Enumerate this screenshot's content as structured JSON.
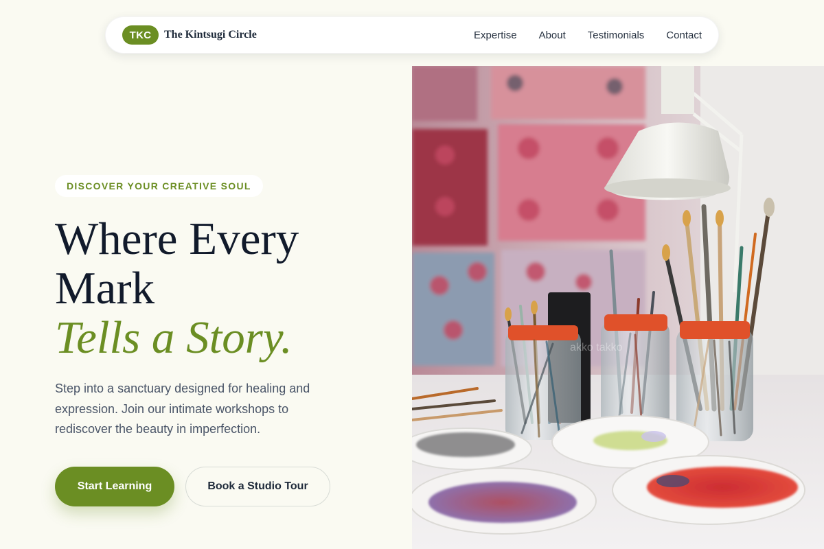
{
  "nav": {
    "badge": "TKC",
    "brand": "The Kintsugi Circle",
    "links": [
      {
        "label": "Expertise"
      },
      {
        "label": "About"
      },
      {
        "label": "Testimonials"
      },
      {
        "label": "Contact"
      }
    ]
  },
  "hero": {
    "eyebrow": "DISCOVER YOUR CREATIVE SOUL",
    "headline_line1": "Where Every",
    "headline_line2": "Mark",
    "headline_accent": "Tells a Story.",
    "lede": "Step into a sanctuary designed for healing and expression. Join our intimate workshops to rediscover the beauty in imperfection.",
    "primary_cta": "Start Learning",
    "secondary_cta": "Book a Studio Tour"
  },
  "image": {
    "subject": "studio-art-supplies-photo"
  },
  "colors": {
    "accent": "#6b8e23",
    "background": "#fafaf2",
    "text": "#111a2b",
    "muted": "#4a5568"
  }
}
